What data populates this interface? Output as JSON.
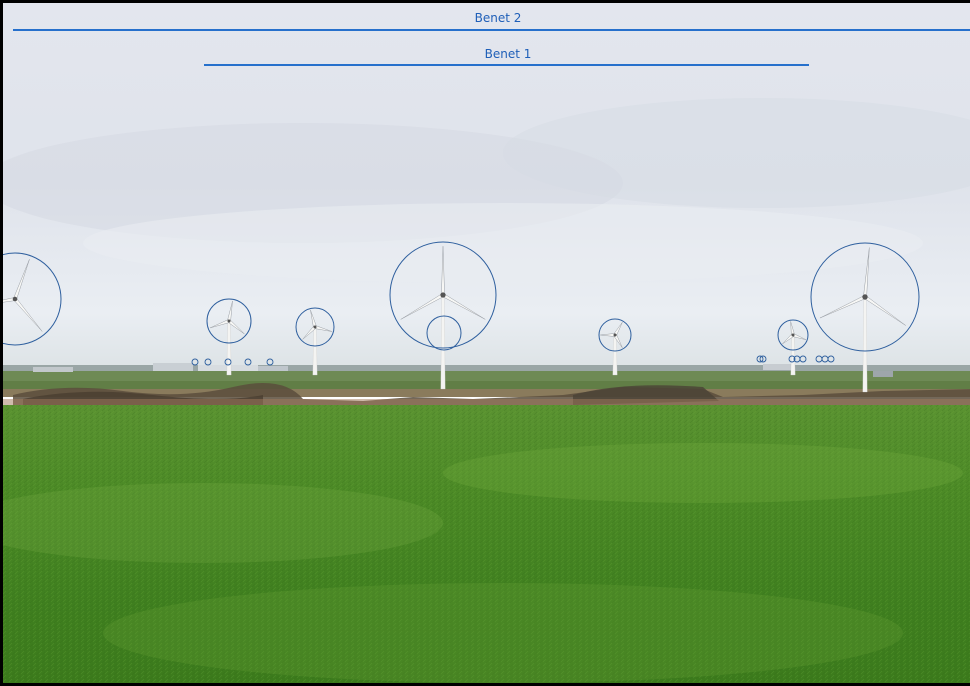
{
  "labels": {
    "group_2": "Benet 2",
    "group_1": "Benet 1"
  },
  "colors": {
    "annotation_line": "#2670cc",
    "annotation_text": "#1f5fb8",
    "circle_stroke": "#2e5f9e",
    "sky_top": "#dfe3ec",
    "sky_bottom": "#eef1f5",
    "field_far": "#4f8a2a",
    "field_near": "#3d7a1d"
  },
  "icons": [
    "wind-turbine-icon",
    "turbine-outline-circle"
  ]
}
